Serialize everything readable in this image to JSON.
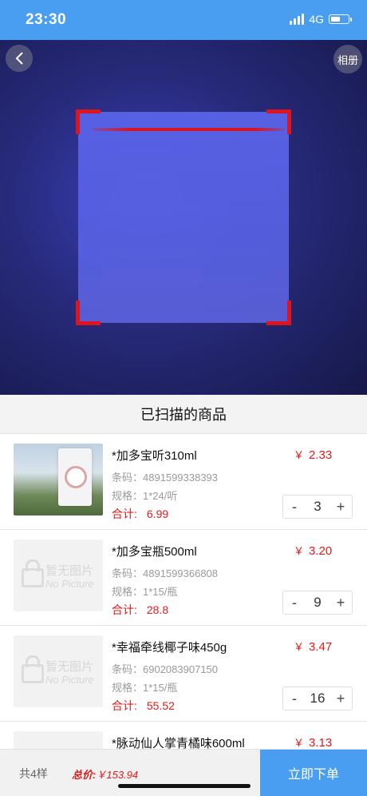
{
  "status_bar": {
    "time": "23:30",
    "network": "4G"
  },
  "camera": {
    "album_label": "相册"
  },
  "section_title": "已扫描的商品",
  "items": [
    {
      "name": "*加多宝听310ml",
      "code_label": "条码：",
      "code": "4891599338393",
      "spec_label": "规格：",
      "spec": "1*24/听",
      "subtotal_label": "合计:",
      "subtotal": "6.99",
      "currency": "￥",
      "price": "2.33",
      "qty": "3",
      "image": "product-photo"
    },
    {
      "name": "*加多宝瓶500ml",
      "code_label": "条码：",
      "code": "4891599366808",
      "spec_label": "规格：",
      "spec": "1*15/瓶",
      "subtotal_label": "合计:",
      "subtotal": "28.8",
      "currency": "￥",
      "price": "3.20",
      "qty": "9",
      "image": "no-picture",
      "placeholder_cn": "暂无图片",
      "placeholder_en": "No Picture"
    },
    {
      "name": "*幸福牵线椰子味450g",
      "code_label": "条码：",
      "code": "6902083907150",
      "spec_label": "规格：",
      "spec": "1*15/瓶",
      "subtotal_label": "合计:",
      "subtotal": "55.52",
      "currency": "￥",
      "price": "3.47",
      "qty": "16",
      "image": "no-picture",
      "placeholder_cn": "暂无图片",
      "placeholder_en": "No Picture"
    },
    {
      "name": "*脉动仙人掌青橘味600ml",
      "currency": "￥",
      "price": "3.13",
      "image": "no-picture"
    }
  ],
  "stepper": {
    "minus": "-",
    "plus": "+"
  },
  "footer": {
    "count": "共4样",
    "total_label": "总价:",
    "total_currency": "￥",
    "total": "153.94",
    "order_button": "立即下单"
  },
  "colors": {
    "accent": "#4a9ef2",
    "price_red": "#e11a1a",
    "scan_red": "#e3141d"
  }
}
